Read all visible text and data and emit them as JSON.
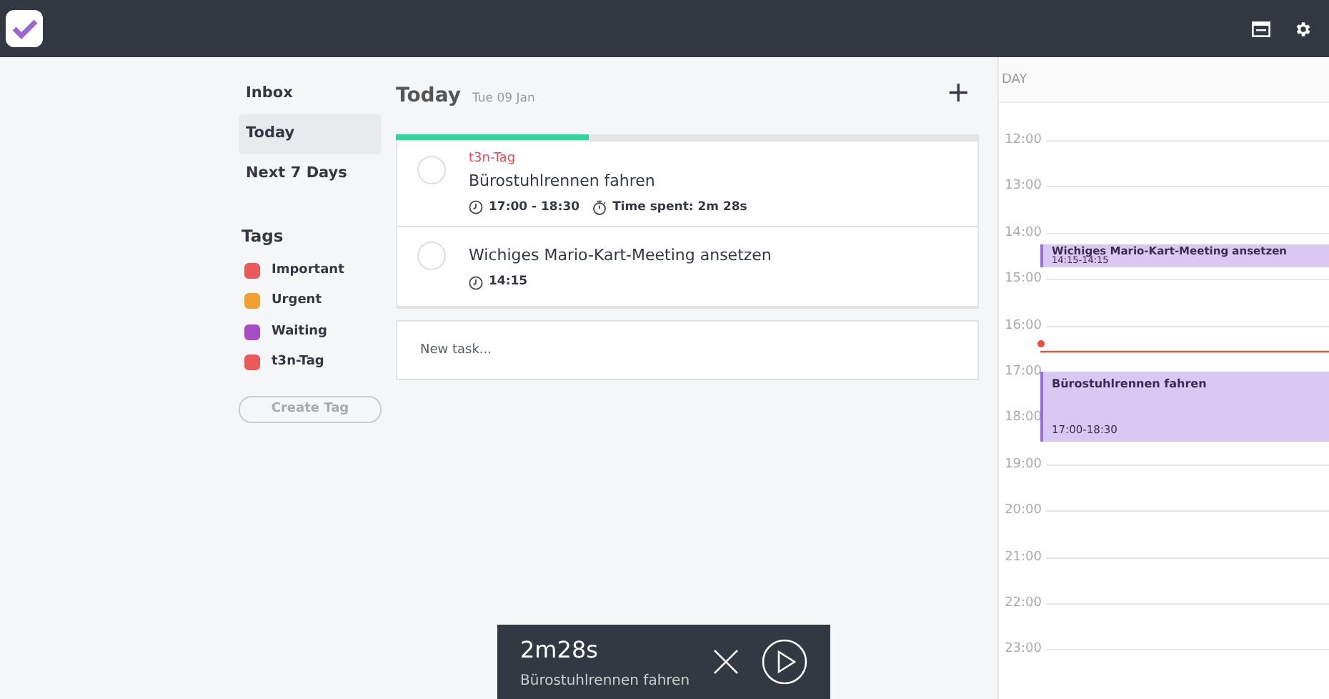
{
  "sidebar": {
    "items": [
      {
        "label": "Inbox",
        "selected": false
      },
      {
        "label": "Today",
        "selected": true
      },
      {
        "label": "Next 7 Days",
        "selected": false
      }
    ],
    "tags_title": "Tags",
    "tags": [
      {
        "label": "Important",
        "color": "#eb5a5a"
      },
      {
        "label": "Urgent",
        "color": "#f0a030"
      },
      {
        "label": "Waiting",
        "color": "#a64dc4"
      },
      {
        "label": "t3n-Tag",
        "color": "#eb5a5a"
      }
    ],
    "create_tag_button": "Create Tag"
  },
  "main": {
    "title": "Today",
    "date": "Tue 09 Jan",
    "add_button": "+",
    "progress": {
      "level": 0.33
    },
    "tasks": [
      {
        "tag": "t3n-Tag",
        "color": "#f2454d",
        "title": "Bürostuhlrennen fahren",
        "time": "17:00 - 18:30",
        "time_spent": "Time spent: 2m 28s",
        "checked": false
      },
      {
        "title": "Wichiges Mario-Kart-Meeting ansetzen",
        "time": "14:15",
        "checked": false
      }
    ],
    "new_task": {
      "placeholder": "New task..."
    }
  },
  "calendar": {
    "header": "DAY",
    "hours": [
      "12:00",
      "13:00",
      "14:00",
      "15:00",
      "16:00",
      "17:00",
      "18:00",
      "19:00",
      "20:00",
      "21:00",
      "22:00",
      "23:00"
    ],
    "events": [
      {
        "title": "Wichiges Mario-Kart-Meeting ansetzen",
        "time": "14:15-14:15"
      },
      {
        "title": "Bürostuhlrennen fahren",
        "time": "17:00-18:30"
      }
    ]
  },
  "timer": {
    "elapsed": "2m28s",
    "task": "Bürostuhlrennen fahren"
  }
}
